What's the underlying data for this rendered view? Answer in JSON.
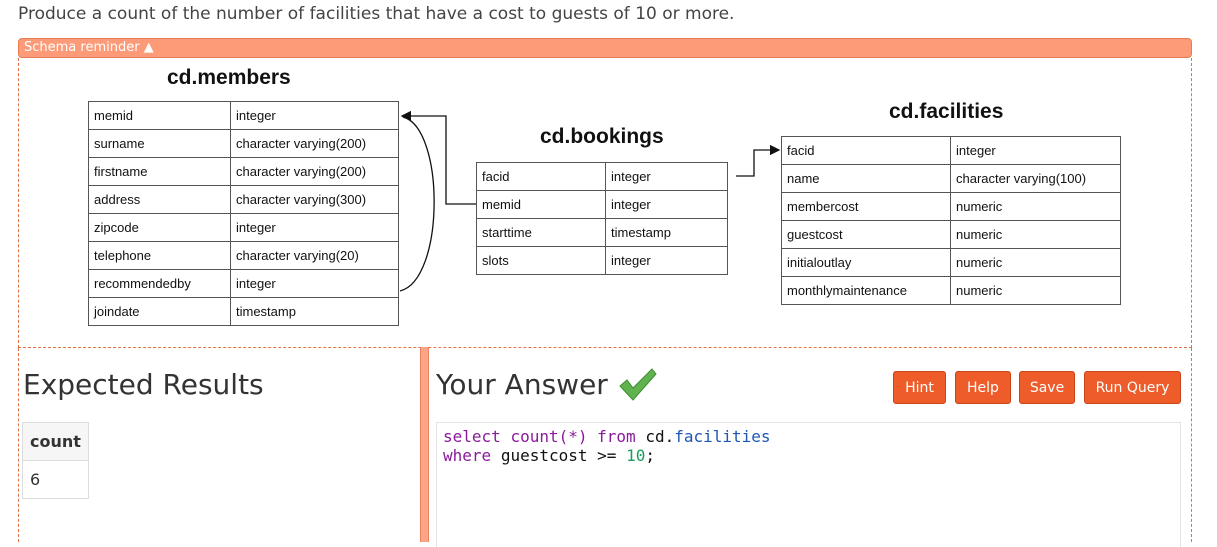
{
  "question": "Produce a count of the number of facilities that have a cost to guests of 10 or more.",
  "schema_toggle": "Schema reminder ▲",
  "schema": {
    "members": {
      "title": "cd.members",
      "rows": [
        [
          "memid",
          "integer"
        ],
        [
          "surname",
          "character varying(200)"
        ],
        [
          "firstname",
          "character varying(200)"
        ],
        [
          "address",
          "character varying(300)"
        ],
        [
          "zipcode",
          "integer"
        ],
        [
          "telephone",
          "character varying(20)"
        ],
        [
          "recommendedby",
          "integer"
        ],
        [
          "joindate",
          "timestamp"
        ]
      ]
    },
    "bookings": {
      "title": "cd.bookings",
      "rows": [
        [
          "facid",
          "integer"
        ],
        [
          "memid",
          "integer"
        ],
        [
          "starttime",
          "timestamp"
        ],
        [
          "slots",
          "integer"
        ]
      ]
    },
    "facilities": {
      "title": "cd.facilities",
      "rows": [
        [
          "facid",
          "integer"
        ],
        [
          "name",
          "character varying(100)"
        ],
        [
          "membercost",
          "numeric"
        ],
        [
          "guestcost",
          "numeric"
        ],
        [
          "initialoutlay",
          "numeric"
        ],
        [
          "monthlymaintenance",
          "numeric"
        ]
      ]
    }
  },
  "expected": {
    "heading": "Expected Results",
    "column": "count",
    "value": "6"
  },
  "answer": {
    "heading": "Your Answer",
    "status": "correct-check-icon",
    "query_line1": [
      "select",
      "count(*)",
      "from",
      "cd.",
      "facilities"
    ],
    "query_line2": [
      "where",
      "guestcost",
      ">=",
      "10",
      ";"
    ]
  },
  "buttons": {
    "hint": "Hint",
    "help": "Help",
    "save": "Save",
    "run": "Run Query"
  },
  "colors": {
    "accent": "#ee5c2a",
    "schema_bar": "#fd9b78",
    "check": "#5fb24e"
  }
}
